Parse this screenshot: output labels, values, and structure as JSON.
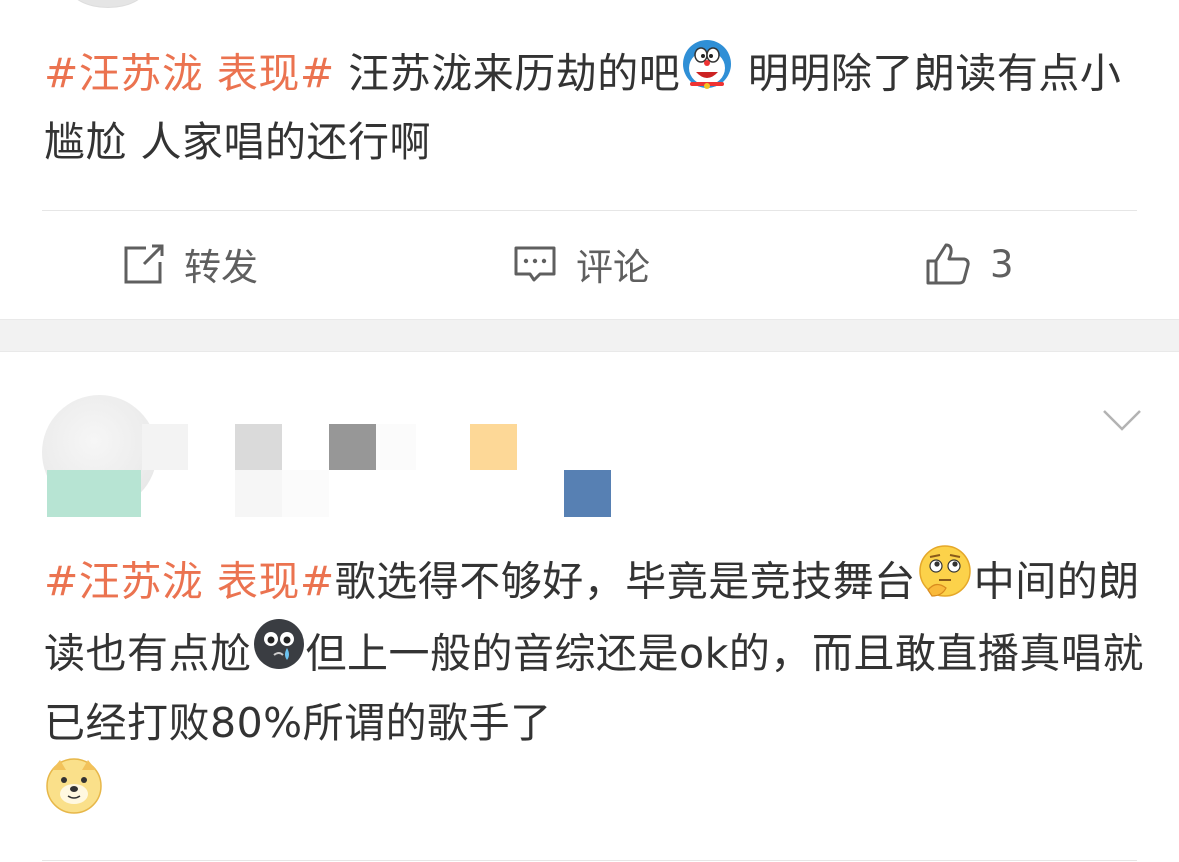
{
  "post1": {
    "tag": "#汪苏泷 表现#",
    "text_a": " 汪苏泷来历劫的吧",
    "text_b": " 明明除了朗读有点小尴尬 人家唱的还行啊",
    "emoji_name": "doraemon-emoji"
  },
  "actions": {
    "repost_label": "转发",
    "comment_label": "评论",
    "like_count": "3"
  },
  "post2": {
    "tag": "#汪苏泷 表现#",
    "text_a": "歌选得不够好，毕竟是竞技舞台",
    "text_b": "中间的朗读也有点尬",
    "text_c": "但上一般的音综还是ok的，而且敢直播真唱就已经打败80%所谓的歌手了",
    "emojis": [
      "thinking-emoji",
      "crying-emoji",
      "doge-emoji"
    ]
  },
  "colors": {
    "tag": "#eb7350",
    "text": "#333333",
    "icon": "#5f5f5f",
    "separator": "#f2f2f2"
  }
}
